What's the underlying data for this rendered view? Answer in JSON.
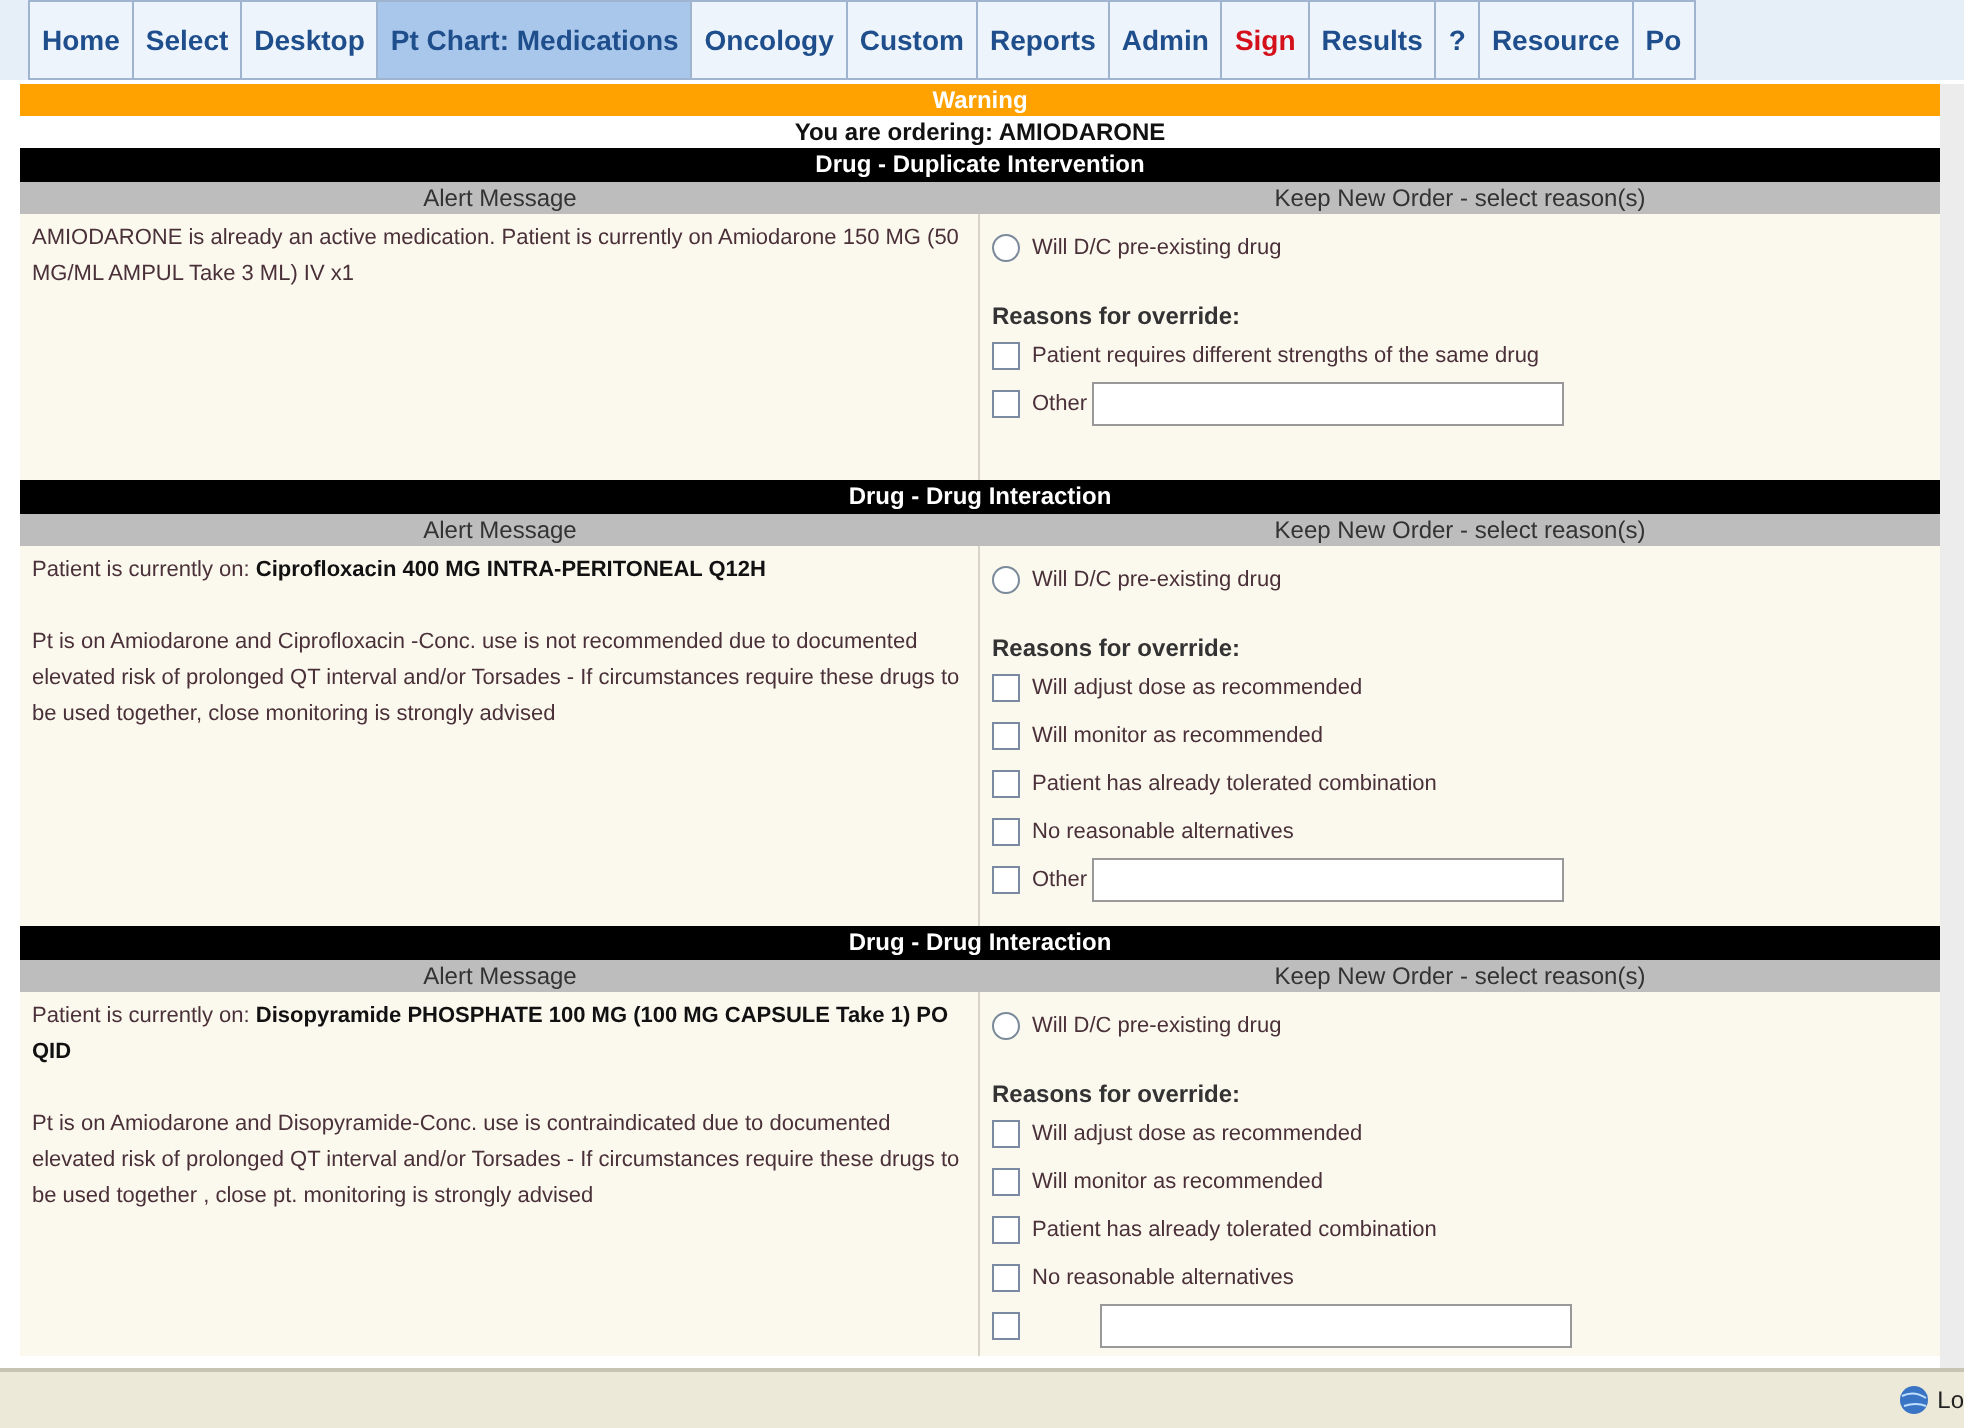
{
  "tabs": [
    {
      "label": "Home",
      "selected": false,
      "color": "#1f4e8c"
    },
    {
      "label": "Select",
      "selected": false,
      "color": "#1f4e8c"
    },
    {
      "label": "Desktop",
      "selected": false,
      "color": "#1f4e8c"
    },
    {
      "label": "Pt Chart: Medications",
      "selected": true,
      "color": "#1f4e8c"
    },
    {
      "label": "Oncology",
      "selected": false,
      "color": "#1f4e8c"
    },
    {
      "label": "Custom",
      "selected": false,
      "color": "#1f4e8c"
    },
    {
      "label": "Reports",
      "selected": false,
      "color": "#1f4e8c"
    },
    {
      "label": "Admin",
      "selected": false,
      "color": "#1f4e8c"
    },
    {
      "label": "Sign",
      "selected": false,
      "color": "#d4101a"
    },
    {
      "label": "Results",
      "selected": false,
      "color": "#1f4e8c"
    },
    {
      "label": "?",
      "selected": false,
      "color": "#1f4e8c"
    },
    {
      "label": "Resource",
      "selected": false,
      "color": "#1f4e8c"
    },
    {
      "label": "Po",
      "selected": false,
      "color": "#1f4e8c"
    }
  ],
  "warning": {
    "title": "Warning",
    "ordering": "You are ordering: AMIODARONE"
  },
  "alerts": [
    {
      "title": "Drug - Duplicate Intervention",
      "left_header": "Alert Message",
      "right_header": "Keep New Order - select reason(s)",
      "message": [
        "AMIODARONE is already an active medication. Patient is currently on Amiodarone 150 MG (50 MG/ML AMPUL Take 3 ML) IV x1"
      ],
      "dc_option": {
        "label": "Will D/C pre-existing drug",
        "selected": false
      },
      "reasons_label": "Reasons for override:",
      "reasons": [
        {
          "label": "Patient requires different strengths of the same drug",
          "checked": false
        }
      ],
      "other": {
        "label": "Other",
        "checked": false
      }
    },
    {
      "title": "Drug - Drug Interaction",
      "left_header": "Alert Message",
      "right_header": "Keep New Order - select reason(s)",
      "message": [
        "Patient is currently on: **Ciprofloxacin 400 MG INTRA-PERITONEAL Q12H**",
        "Pt is on Amiodarone and Ciprofloxacin -Conc. use is not recommended due to documented elevated risk of prolonged QT interval and/or Torsades - If circumstances require these drugs to be used together, close monitoring is strongly advised"
      ],
      "dc_option": {
        "label": "Will D/C pre-existing drug",
        "selected": false
      },
      "reasons_label": "Reasons for override:",
      "reasons": [
        {
          "label": "Will adjust dose as recommended",
          "checked": false
        },
        {
          "label": "Will monitor as recommended",
          "checked": false
        },
        {
          "label": "Patient has already tolerated combination",
          "checked": false
        },
        {
          "label": "No reasonable alternatives",
          "checked": false
        }
      ],
      "other": {
        "label": "Other",
        "checked": false
      }
    },
    {
      "title": "Drug - Drug Interaction",
      "left_header": "Alert Message",
      "right_header": "Keep New Order - select reason(s)",
      "message": [
        "Patient is currently on: **Disopyramide PHOSPHATE 100 MG (100 MG CAPSULE Take 1) PO QID**",
        "Pt is on Amiodarone and Disopyramide-Conc. use is contraindicated due to documented elevated risk of prolonged QT interval and/or Torsades - If circumstances require these drugs to be used together , close pt. monitoring is strongly advised"
      ],
      "dc_option": {
        "label": "Will D/C pre-existing drug",
        "selected": false
      },
      "reasons_label": "Reasons for override:",
      "reasons": [
        {
          "label": "Will adjust dose as recommended",
          "checked": false
        },
        {
          "label": "Will monitor as recommended",
          "checked": false
        },
        {
          "label": "Patient has already tolerated combination",
          "checked": false
        },
        {
          "label": "No reasonable alternatives",
          "checked": false
        }
      ],
      "other": {
        "checked": false
      }
    }
  ],
  "status_bar": {
    "text": "Lo"
  }
}
